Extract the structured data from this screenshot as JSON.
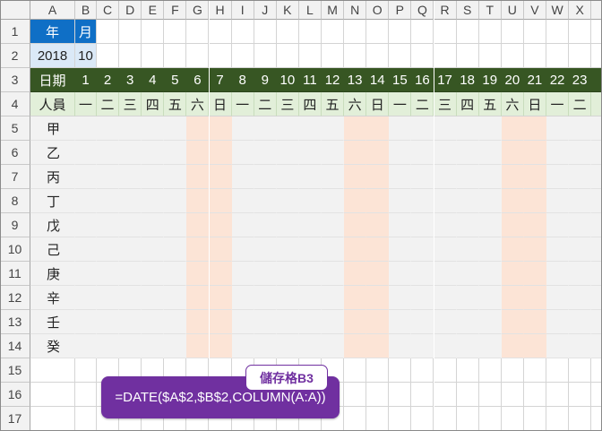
{
  "columns": [
    "A",
    "B",
    "C",
    "D",
    "E",
    "F",
    "G",
    "H",
    "I",
    "J",
    "K",
    "L",
    "M",
    "N",
    "O",
    "P",
    "Q",
    "R",
    "S",
    "T",
    "U",
    "V",
    "W",
    "X"
  ],
  "rows": [
    "1",
    "2",
    "3",
    "4",
    "5",
    "6",
    "7",
    "8",
    "9",
    "10",
    "11",
    "12",
    "13",
    "14",
    "15",
    "16",
    "17"
  ],
  "cells": {
    "year_label": "年",
    "month_label": "月",
    "year_value": "2018",
    "month_value": "10",
    "date_header": "日期",
    "person_header": "人員"
  },
  "days": [
    "1",
    "2",
    "3",
    "4",
    "5",
    "6",
    "7",
    "8",
    "9",
    "10",
    "11",
    "12",
    "13",
    "14",
    "15",
    "16",
    "17",
    "18",
    "19",
    "20",
    "21",
    "22",
    "23"
  ],
  "weekdays": [
    "一",
    "二",
    "三",
    "四",
    "五",
    "六",
    "日",
    "一",
    "二",
    "三",
    "四",
    "五",
    "六",
    "日",
    "一",
    "二",
    "三",
    "四",
    "五",
    "六",
    "日",
    "一",
    "二"
  ],
  "people": [
    "甲",
    "乙",
    "丙",
    "丁",
    "戊",
    "己",
    "庚",
    "辛",
    "壬",
    "癸"
  ],
  "weekend_day_indices": [
    5,
    6,
    12,
    13,
    19,
    20
  ],
  "callout": {
    "tag": "儲存格B3",
    "formula": "=DATE($A$2,$B$2,COLUMN(A:A))"
  },
  "colors": {
    "header_blue": "#0f6fc6",
    "header_green": "#375623",
    "weekday_row": "#e2efd9",
    "weekend_fill": "#fce4d6",
    "callout_purple": "#7030a0"
  }
}
